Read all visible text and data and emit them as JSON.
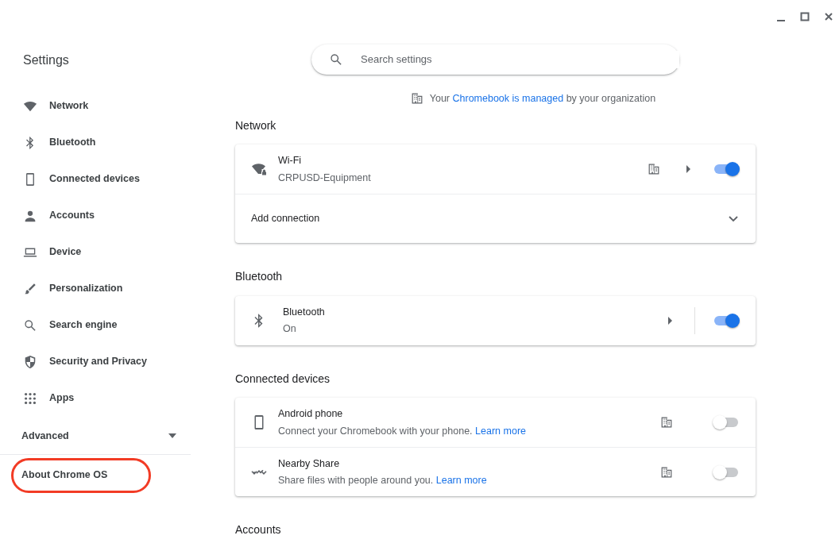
{
  "sidebar": {
    "title": "Settings",
    "items": [
      {
        "label": "Network",
        "selected": false
      },
      {
        "label": "Bluetooth",
        "selected": false
      },
      {
        "label": "Connected devices",
        "selected": false
      },
      {
        "label": "Accounts",
        "selected": false
      },
      {
        "label": "Device",
        "selected": false
      },
      {
        "label": "Personalization",
        "selected": false
      },
      {
        "label": "Search engine",
        "selected": false
      },
      {
        "label": "Security and Privacy",
        "selected": false
      },
      {
        "label": "Apps",
        "selected": false
      }
    ],
    "advanced": {
      "label": "Advanced",
      "expanded": false
    },
    "about": {
      "label": "About Chrome OS",
      "circled": true
    }
  },
  "search": {
    "placeholder": "Search settings"
  },
  "managed_notice": {
    "before": "Your",
    "link": "Chromebook is managed",
    "after": "by your organization"
  },
  "sections": [
    {
      "title": "Network",
      "rows": [
        {
          "kind": "toggle",
          "title": "Wi-Fi",
          "subtitle": "CRPUSD-Equipment",
          "managed": true,
          "arrow": true,
          "on": true
        },
        {
          "kind": "expand",
          "title": "Add connection",
          "expanded": false
        }
      ]
    },
    {
      "title": "Bluetooth",
      "rows": [
        {
          "kind": "toggle",
          "title": "Bluetooth",
          "subtitle": "On",
          "managed": false,
          "arrow": true,
          "on": true
        }
      ]
    },
    {
      "title": "Connected devices",
      "rows": [
        {
          "kind": "toggle",
          "title": "Android phone",
          "subtitle": "Connect your Chromebook with your phone.",
          "link": "Learn more",
          "managed": true,
          "arrow": false,
          "on": false
        },
        {
          "kind": "toggle",
          "title": "Nearby Share",
          "subtitle": "Share files with people around you.",
          "link": "Learn more",
          "managed": true,
          "arrow": false,
          "on": false
        }
      ]
    },
    {
      "title": "Accounts"
    }
  ]
}
